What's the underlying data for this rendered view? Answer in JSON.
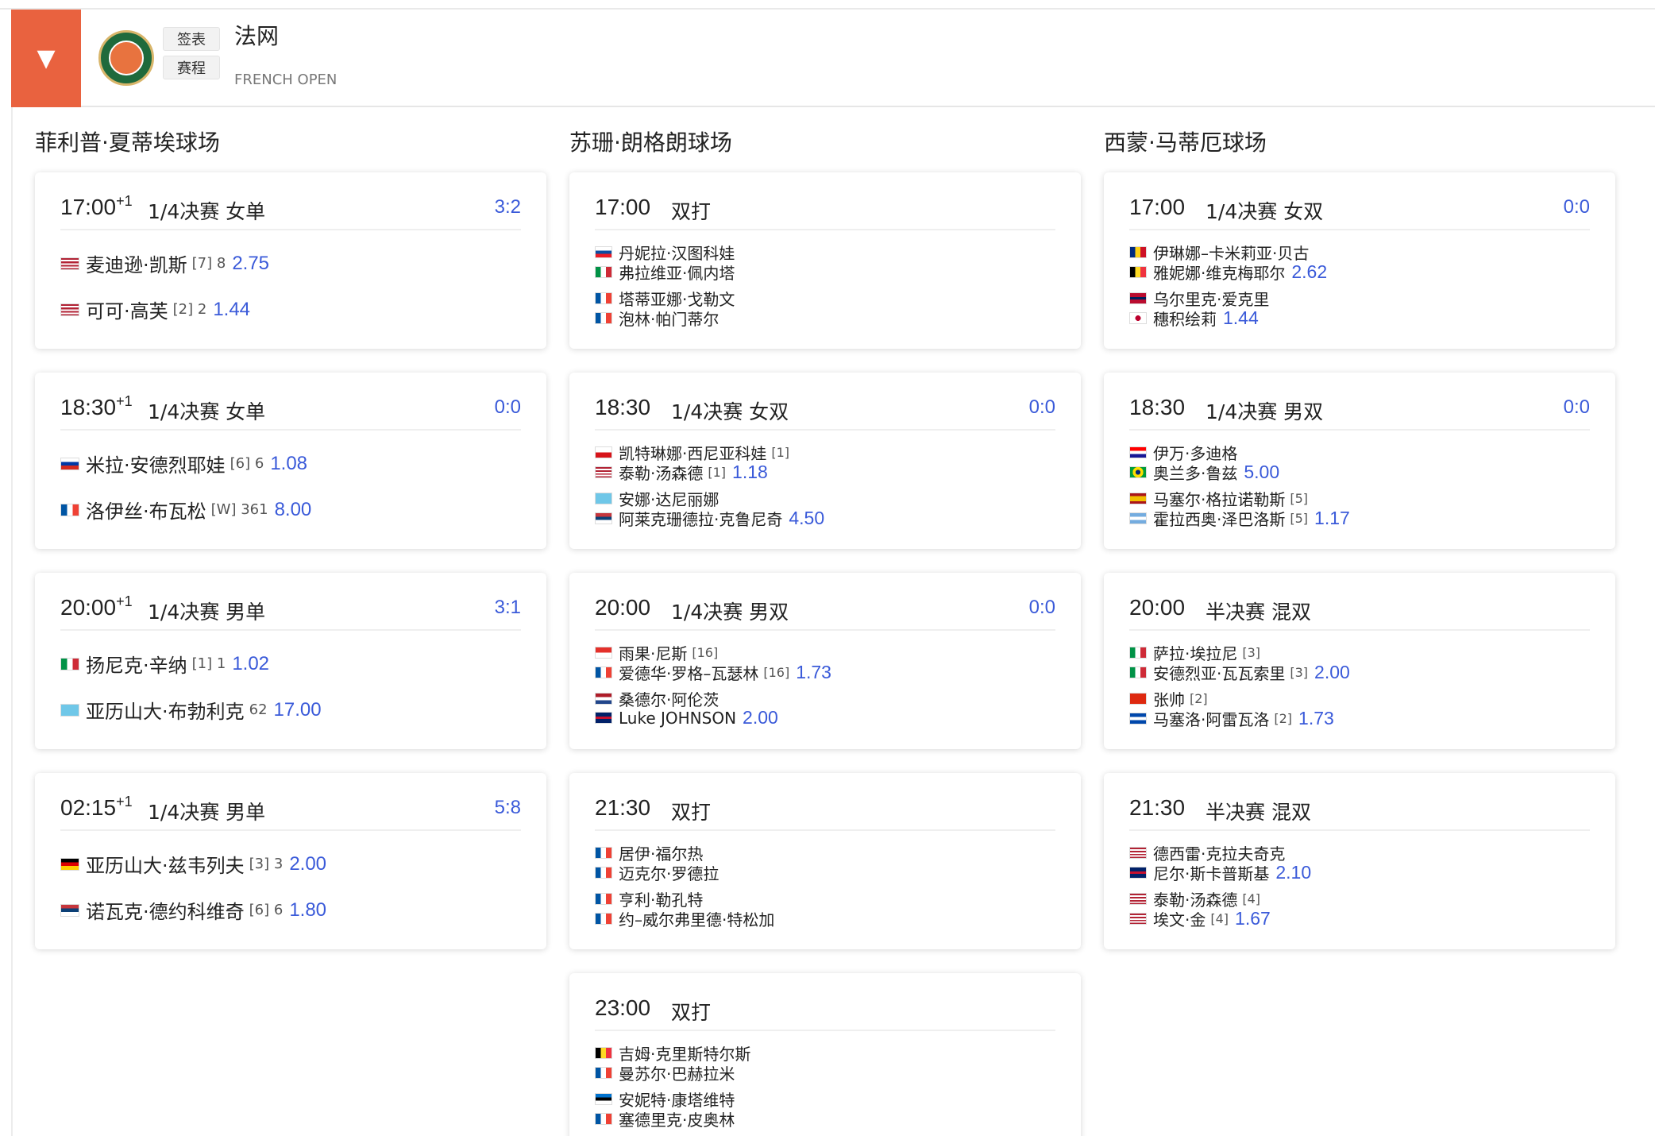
{
  "header": {
    "toggle_icon": "▼",
    "logo_label": "Roland Garros logo",
    "btn_draw": "签表",
    "btn_schedule": "赛程",
    "title": "法网",
    "subtitle": "FRENCH OPEN"
  },
  "columns": [
    {
      "title": "菲利普·夏蒂埃球场",
      "matches": [
        {
          "time": "17:00",
          "plus": "+1",
          "round": "1/4决赛 女单",
          "score": "3:2",
          "type": "singles",
          "players": [
            {
              "flag": "us",
              "name": "麦迪逊·凯斯",
              "seed": "[7] 8",
              "odds": "2.75"
            },
            {
              "flag": "us",
              "name": "可可·高芙",
              "seed": "[2] 2",
              "odds": "1.44"
            }
          ]
        },
        {
          "time": "18:30",
          "plus": "+1",
          "round": "1/4决赛 女单",
          "score": "0:0",
          "type": "singles",
          "players": [
            {
              "flag": "ru",
              "name": "米拉·安德烈耶娃",
              "seed": "[6] 6",
              "odds": "1.08"
            },
            {
              "flag": "fr",
              "name": "洛伊丝·布瓦松",
              "seed": "[W] 361",
              "odds": "8.00"
            }
          ]
        },
        {
          "time": "20:00",
          "plus": "+1",
          "round": "1/4决赛 男单",
          "score": "3:1",
          "type": "singles",
          "players": [
            {
              "flag": "it",
              "name": "扬尼克·辛纳",
              "seed": "[1] 1",
              "odds": "1.02"
            },
            {
              "flag": "kz",
              "name": "亚历山大·布勃利克",
              "seed": "62",
              "odds": "17.00"
            }
          ]
        },
        {
          "time": "02:15",
          "plus": "+1",
          "round": "1/4决赛 男单",
          "score": "5:8",
          "type": "singles",
          "players": [
            {
              "flag": "de",
              "name": "亚历山大·兹韦列夫",
              "seed": "[3] 3",
              "odds": "2.00"
            },
            {
              "flag": "rs",
              "name": "诺瓦克·德约科维奇",
              "seed": "[6] 6",
              "odds": "1.80"
            }
          ]
        }
      ]
    },
    {
      "title": "苏珊·朗格朗球场",
      "matches": [
        {
          "time": "17:00",
          "plus": "",
          "round": "双打",
          "score": "",
          "type": "doubles",
          "players": [
            {
              "flag": "sk",
              "name": "丹妮拉·汉图科娃",
              "seed": "",
              "odds": ""
            },
            {
              "flag": "it",
              "name": "弗拉维亚·佩内塔",
              "seed": "",
              "odds": ""
            },
            {
              "flag": "fr",
              "name": "塔蒂亚娜·戈勒文",
              "seed": "",
              "odds": ""
            },
            {
              "flag": "fr",
              "name": "泡林·帕门蒂尔",
              "seed": "",
              "odds": ""
            }
          ]
        },
        {
          "time": "18:30",
          "plus": "",
          "round": "1/4决赛 女双",
          "score": "0:0",
          "type": "doubles",
          "players": [
            {
              "flag": "cz",
              "name": "凯特琳娜·西尼亚科娃",
              "seed": "[1]",
              "odds": ""
            },
            {
              "flag": "us",
              "name": "泰勒·汤森德",
              "seed": "[1]",
              "odds": "1.18"
            },
            {
              "flag": "kz",
              "name": "安娜·达尼丽娜",
              "seed": "",
              "odds": ""
            },
            {
              "flag": "rs",
              "name": "阿莱克珊德拉·克鲁尼奇",
              "seed": "",
              "odds": "4.50"
            }
          ]
        },
        {
          "time": "20:00",
          "plus": "",
          "round": "1/4决赛 男双",
          "score": "0:0",
          "type": "doubles",
          "players": [
            {
              "flag": "id",
              "name": "雨果·尼斯",
              "seed": "[16]",
              "odds": ""
            },
            {
              "flag": "fr",
              "name": "爱德华·罗格–瓦瑟林",
              "seed": "[16]",
              "odds": "1.73"
            },
            {
              "flag": "nl",
              "name": "桑德尔·阿伦茨",
              "seed": "",
              "odds": ""
            },
            {
              "flag": "gb",
              "name": "Luke JOHNSON",
              "seed": "",
              "odds": "2.00"
            }
          ]
        },
        {
          "time": "21:30",
          "plus": "",
          "round": "双打",
          "score": "",
          "type": "doubles",
          "players": [
            {
              "flag": "fr",
              "name": "居伊·福尔热",
              "seed": "",
              "odds": ""
            },
            {
              "flag": "fr",
              "name": "迈克尔·罗德拉",
              "seed": "",
              "odds": ""
            },
            {
              "flag": "fr",
              "name": "亨利·勒孔特",
              "seed": "",
              "odds": ""
            },
            {
              "flag": "fr",
              "name": "约–威尔弗里德·特松加",
              "seed": "",
              "odds": ""
            }
          ]
        },
        {
          "time": "23:00",
          "plus": "",
          "round": "双打",
          "score": "",
          "type": "doubles",
          "players": [
            {
              "flag": "be",
              "name": "吉姆·克里斯特尔斯",
              "seed": "",
              "odds": ""
            },
            {
              "flag": "fr",
              "name": "曼苏尔·巴赫拉米",
              "seed": "",
              "odds": ""
            },
            {
              "flag": "ee",
              "name": "安妮特·康塔维特",
              "seed": "",
              "odds": ""
            },
            {
              "flag": "fr",
              "name": "塞德里克·皮奥林",
              "seed": "",
              "odds": ""
            }
          ]
        }
      ]
    },
    {
      "title": "西蒙·马蒂厄球场",
      "matches": [
        {
          "time": "17:00",
          "plus": "",
          "round": "1/4决赛 女双",
          "score": "0:0",
          "type": "doubles",
          "players": [
            {
              "flag": "ro",
              "name": "伊琳娜–卡米莉亚·贝古",
              "seed": "",
              "odds": ""
            },
            {
              "flag": "be",
              "name": "雅妮娜·维克梅耶尔",
              "seed": "",
              "odds": "2.62"
            },
            {
              "flag": "no",
              "name": "乌尔里克·爱克里",
              "seed": "",
              "odds": ""
            },
            {
              "flag": "jp",
              "name": "穗积绘莉",
              "seed": "",
              "odds": "1.44"
            }
          ]
        },
        {
          "time": "18:30",
          "plus": "",
          "round": "1/4决赛 男双",
          "score": "0:0",
          "type": "doubles",
          "players": [
            {
              "flag": "hr",
              "name": "伊万·多迪格",
              "seed": "",
              "odds": ""
            },
            {
              "flag": "br",
              "name": "奥兰多·鲁兹",
              "seed": "",
              "odds": "5.00"
            },
            {
              "flag": "es",
              "name": "马塞尔·格拉诺勒斯",
              "seed": "[5]",
              "odds": ""
            },
            {
              "flag": "ar",
              "name": "霍拉西奥·泽巴洛斯",
              "seed": "[5]",
              "odds": "1.17"
            }
          ]
        },
        {
          "time": "20:00",
          "plus": "",
          "round": "半决赛 混双",
          "score": "",
          "type": "doubles",
          "players": [
            {
              "flag": "it",
              "name": "萨拉·埃拉尼",
              "seed": "[3]",
              "odds": ""
            },
            {
              "flag": "it",
              "name": "安德烈亚·瓦瓦索里",
              "seed": "[3]",
              "odds": "2.00"
            },
            {
              "flag": "cn",
              "name": "张帅",
              "seed": "[2]",
              "odds": ""
            },
            {
              "flag": "sv",
              "name": "马塞洛·阿雷瓦洛",
              "seed": "[2]",
              "odds": "1.73"
            }
          ]
        },
        {
          "time": "21:30",
          "plus": "",
          "round": "半决赛 混双",
          "score": "",
          "type": "doubles",
          "players": [
            {
              "flag": "us",
              "name": "德西雷·克拉夫奇克",
              "seed": "",
              "odds": ""
            },
            {
              "flag": "gb",
              "name": "尼尔·斯卡普斯基",
              "seed": "",
              "odds": "2.10"
            },
            {
              "flag": "us",
              "name": "泰勒·汤森德",
              "seed": "[4]",
              "odds": ""
            },
            {
              "flag": "us",
              "name": "埃文·金",
              "seed": "[4]",
              "odds": "1.67"
            }
          ]
        }
      ]
    }
  ]
}
